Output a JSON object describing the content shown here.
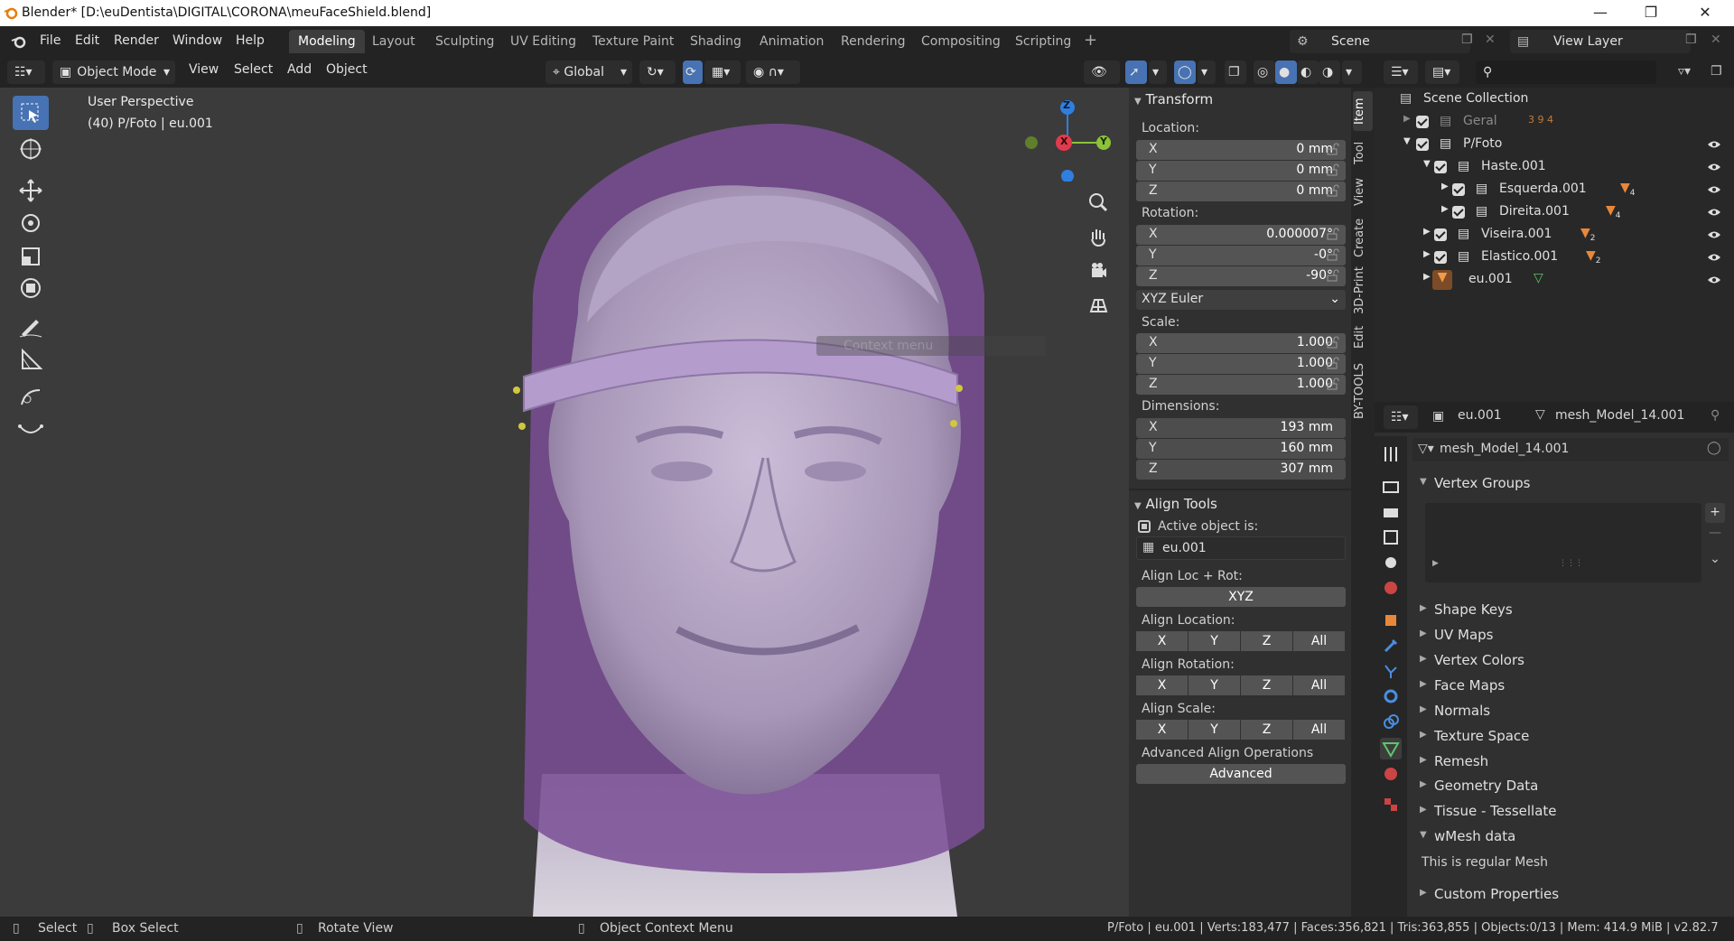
{
  "title_bar": {
    "title": "Blender* [D:\\euDentista\\DIGITAL\\CORONA\\meuFaceShield.blend]"
  },
  "menu": {
    "items": [
      "File",
      "Edit",
      "Render",
      "Window",
      "Help"
    ]
  },
  "workspaces": [
    "Modeling",
    "Layout",
    "Sculpting",
    "UV Editing",
    "Texture Paint",
    "Shading",
    "Animation",
    "Rendering",
    "Compositing",
    "Scripting"
  ],
  "active_workspace": "Modeling",
  "scene": {
    "label": "Scene",
    "view_layer": "View Layer"
  },
  "viewport_header": {
    "mode": "Object Mode",
    "menus": [
      "View",
      "Select",
      "Add",
      "Object"
    ],
    "orientation": "Global"
  },
  "viewport": {
    "perspective": "User Perspective",
    "info": "(40) P/Foto | eu.001",
    "tooltip": "Context menu"
  },
  "gizmo": {
    "x": "X",
    "y": "Y",
    "z": "Z"
  },
  "npanel": {
    "transform": {
      "title": "Transform",
      "location_label": "Location:",
      "location": [
        {
          "axis": "X",
          "value": "0 mm"
        },
        {
          "axis": "Y",
          "value": "0 mm"
        },
        {
          "axis": "Z",
          "value": "0 mm"
        }
      ],
      "rotation_label": "Rotation:",
      "rotation": [
        {
          "axis": "X",
          "value": "0.000007°"
        },
        {
          "axis": "Y",
          "value": "-0°"
        },
        {
          "axis": "Z",
          "value": "-90°"
        }
      ],
      "rotation_mode": "XYZ Euler",
      "scale_label": "Scale:",
      "scale": [
        {
          "axis": "X",
          "value": "1.000"
        },
        {
          "axis": "Y",
          "value": "1.000"
        },
        {
          "axis": "Z",
          "value": "1.000"
        }
      ],
      "dimensions_label": "Dimensions:",
      "dimensions": [
        {
          "axis": "X",
          "value": "193 mm"
        },
        {
          "axis": "Y",
          "value": "160 mm"
        },
        {
          "axis": "Z",
          "value": "307 mm"
        }
      ]
    },
    "align": {
      "title": "Align Tools",
      "active_label": "Active object is:",
      "active_object": "eu.001",
      "loc_rot_label": "Align Loc + Rot:",
      "loc_rot_button": "XYZ",
      "location_label": "Align Location:",
      "rotation_label": "Align Rotation:",
      "scale_label": "Align Scale:",
      "axes": [
        "X",
        "Y",
        "Z",
        "All"
      ],
      "advanced_label": "Advanced Align Operations",
      "advanced_button": "Advanced"
    },
    "tabs": [
      "Item",
      "Tool",
      "View",
      "Create",
      "3D-Print",
      "Edit",
      "BY-TOOLS"
    ]
  },
  "outliner": {
    "root": "Scene Collection",
    "rows": [
      {
        "name": "Geral",
        "counts": "3  9  4"
      },
      {
        "name": "P/Foto"
      },
      {
        "name": "Haste.001"
      },
      {
        "name": "Esquerda.001",
        "badge": "4"
      },
      {
        "name": "Direita.001",
        "badge": "4"
      },
      {
        "name": "Viseira.001",
        "badge": "2"
      },
      {
        "name": "Elastico.001",
        "badge": "2"
      },
      {
        "name": "eu.001"
      }
    ]
  },
  "properties": {
    "object": "eu.001",
    "mesh": "mesh_Model_14.001",
    "mesh_field": "mesh_Model_14.001",
    "sections": [
      "Vertex Groups",
      "Shape Keys",
      "UV Maps",
      "Vertex Colors",
      "Face Maps",
      "Normals",
      "Texture Space",
      "Remesh",
      "Geometry Data",
      "Tissue - Tessellate",
      "wMesh data",
      "Custom Properties"
    ],
    "wmesh_text": "This is regular Mesh"
  },
  "status_bar": {
    "select": "Select",
    "box_select": "Box Select",
    "rotate": "Rotate View",
    "context": "Object Context Menu",
    "stats": "P/Foto | eu.001 | Verts:183,477 | Faces:356,821 | Tris:363,855 | Objects:0/13 | Mem: 414.9 MiB | v2.82.7"
  },
  "colors": {
    "accent": "#4772b3",
    "shield": "#8a5aa6",
    "face": "#b8a8c6",
    "x_axis": "#e23a4d",
    "y_axis": "#8bc23a",
    "z_axis": "#2f7fe0"
  }
}
